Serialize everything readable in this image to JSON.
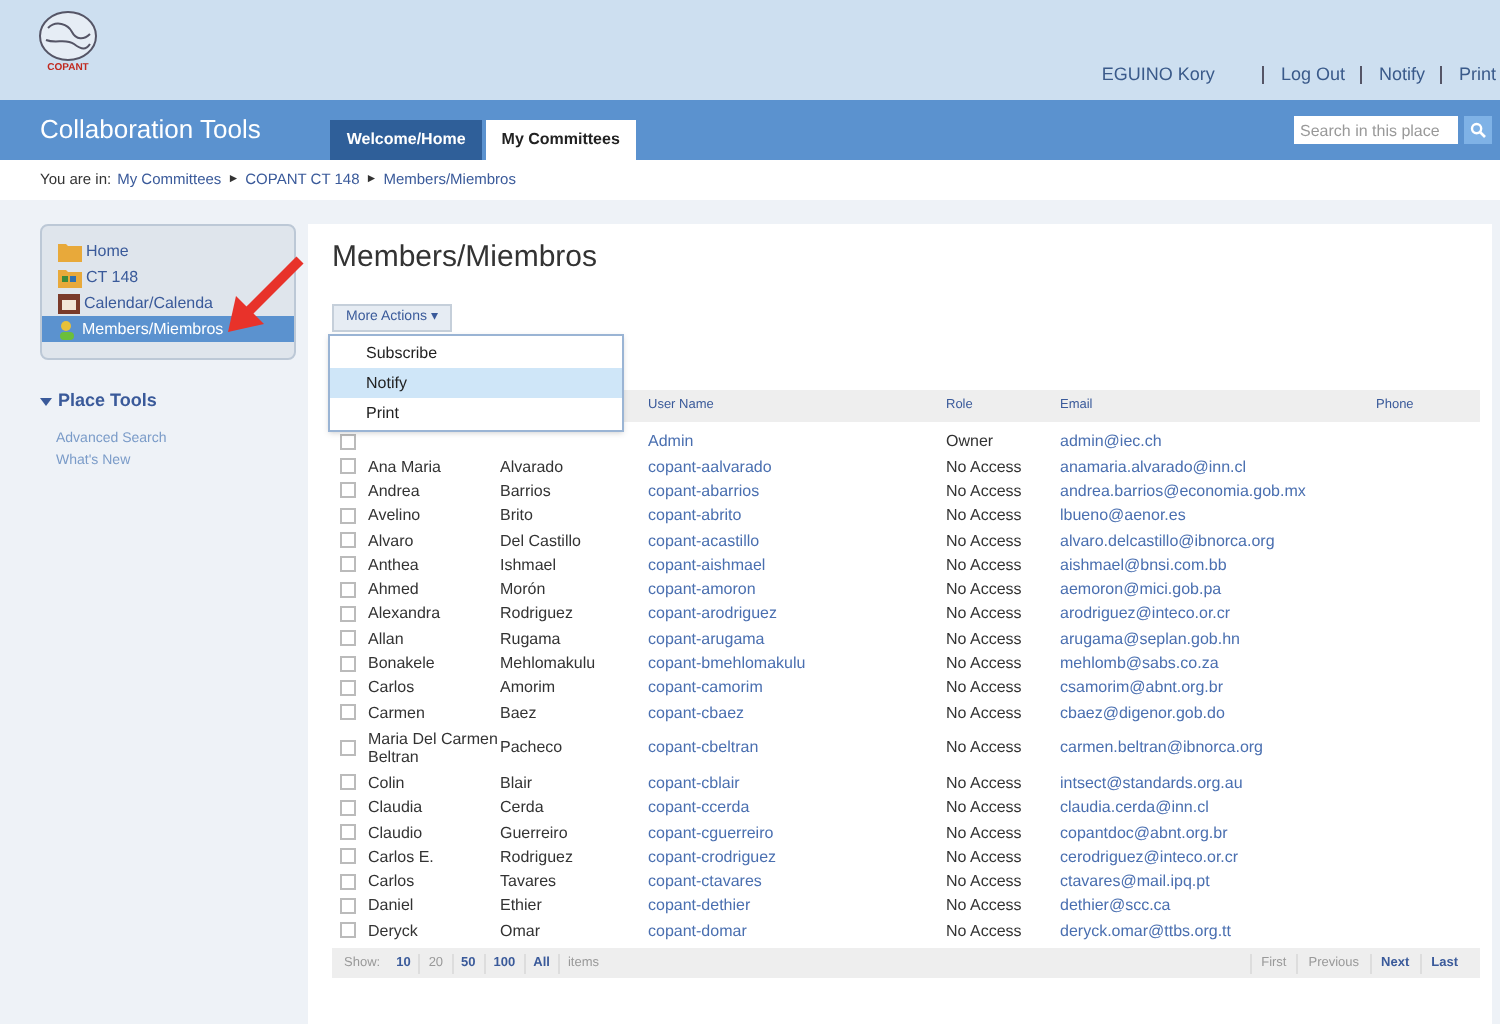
{
  "logo": {
    "text": "COPANT"
  },
  "user_links": [
    "EGUINO Kory",
    "Log Out",
    "Notify",
    "Print"
  ],
  "app_title": "Collaboration Tools",
  "tabs": [
    {
      "label": "Welcome/Home",
      "selected": false
    },
    {
      "label": "My Committees",
      "selected": true
    }
  ],
  "search": {
    "placeholder": "Search in this place"
  },
  "breadcrumb": {
    "label": "You are in:",
    "items": [
      "My Committees",
      "COPANT CT 148",
      "Members/Miembros"
    ],
    "separator": "►"
  },
  "sidebar": {
    "items": [
      {
        "label": "Home",
        "selected": false
      },
      {
        "label": "CT 148",
        "selected": false
      },
      {
        "label": "Calendar/Calenda",
        "selected": false
      },
      {
        "label": "Members/Miembros",
        "selected": true
      }
    ],
    "tools_title": "Place Tools",
    "tools_expanded": true,
    "tools": [
      "Advanced Search",
      "What's New"
    ]
  },
  "page_title": "Members/Miembros",
  "actions_button": "More Actions ▾",
  "actions_menu": [
    {
      "label": "Subscribe",
      "selected": false
    },
    {
      "label": "Notify",
      "selected": true
    },
    {
      "label": "Print",
      "selected": false
    }
  ],
  "table": {
    "columns": [
      "User Name",
      "Role",
      "Email",
      "Phone"
    ],
    "rows": [
      {
        "first": "",
        "last": "",
        "user": "Admin",
        "role": "Owner",
        "email": "admin@iec.ch",
        "checked": false
      },
      {
        "first": "Ana Maria",
        "last": "Alvarado",
        "user": "copant-aalvarado",
        "role": "No Access",
        "email": "anamaria.alvarado@inn.cl",
        "checked": false
      },
      {
        "first": "Andrea",
        "last": "Barrios",
        "user": "copant-abarrios",
        "role": "No Access",
        "email": "andrea.barrios@economia.gob.mx",
        "checked": false
      },
      {
        "first": "Avelino",
        "last": "Brito",
        "user": "copant-abrito",
        "role": "No Access",
        "email": "lbueno@aenor.es",
        "checked": false
      },
      {
        "first": "Alvaro",
        "last": "Del Castillo",
        "user": "copant-acastillo",
        "role": "No Access",
        "email": "alvaro.delcastillo@ibnorca.org",
        "checked": false
      },
      {
        "first": "Anthea",
        "last": "Ishmael",
        "user": "copant-aishmael",
        "role": "No Access",
        "email": "aishmael@bnsi.com.bb",
        "checked": false
      },
      {
        "first": "Ahmed",
        "last": "Morón",
        "user": "copant-amoron",
        "role": "No Access",
        "email": "aemoron@mici.gob.pa",
        "checked": false
      },
      {
        "first": "Alexandra",
        "last": "Rodriguez",
        "user": "copant-arodriguez",
        "role": "No Access",
        "email": "arodriguez@inteco.or.cr",
        "checked": false
      },
      {
        "first": "Allan",
        "last": "Rugama",
        "user": "copant-arugama",
        "role": "No Access",
        "email": "arugama@seplan.gob.hn",
        "checked": false
      },
      {
        "first": "Bonakele",
        "last": "Mehlomakulu",
        "user": "copant-bmehlomakulu",
        "role": "No Access",
        "email": "mehlomb@sabs.co.za",
        "checked": false
      },
      {
        "first": "Carlos",
        "last": "Amorim",
        "user": "copant-camorim",
        "role": "No Access",
        "email": "csamorim@abnt.org.br",
        "checked": false
      },
      {
        "first": "Carmen",
        "last": "Baez",
        "user": "copant-cbaez",
        "role": "No Access",
        "email": "cbaez@digenor.gob.do",
        "checked": false
      },
      {
        "first": "Maria Del Carmen Beltran",
        "last": "Pacheco",
        "user": "copant-cbeltran",
        "role": "No Access",
        "email": "carmen.beltran@ibnorca.org",
        "checked": false
      },
      {
        "first": "Colin",
        "last": "Blair",
        "user": "copant-cblair",
        "role": "No Access",
        "email": "intsect@standards.org.au",
        "checked": false
      },
      {
        "first": "Claudia",
        "last": "Cerda",
        "user": "copant-ccerda",
        "role": "No Access",
        "email": "claudia.cerda@inn.cl",
        "checked": false
      },
      {
        "first": "Claudio",
        "last": "Guerreiro",
        "user": "copant-cguerreiro",
        "role": "No Access",
        "email": "copantdoc@abnt.org.br",
        "checked": false
      },
      {
        "first": "Carlos E.",
        "last": "Rodriguez",
        "user": "copant-crodriguez",
        "role": "No Access",
        "email": "cerodriguez@inteco.or.cr",
        "checked": false
      },
      {
        "first": "Carlos",
        "last": "Tavares",
        "user": "copant-ctavares",
        "role": "No Access",
        "email": "ctavares@mail.ipq.pt",
        "checked": false
      },
      {
        "first": "Daniel",
        "last": "Ethier",
        "user": "copant-dethier",
        "role": "No Access",
        "email": "dethier@scc.ca",
        "checked": false
      },
      {
        "first": "Deryck",
        "last": "Omar",
        "user": "copant-domar",
        "role": "No Access",
        "email": "deryck.omar@ttbs.org.tt",
        "checked": false
      }
    ]
  },
  "pager": {
    "show_label": "Show:",
    "sizes": [
      {
        "label": "10",
        "selected": false
      },
      {
        "label": "20",
        "selected": true
      },
      {
        "label": "50",
        "selected": false
      },
      {
        "label": "100",
        "selected": false
      },
      {
        "label": "All",
        "selected": false
      }
    ],
    "items_label": "items",
    "nav": [
      {
        "label": "First",
        "disabled": true
      },
      {
        "label": "Previous",
        "disabled": true
      },
      {
        "label": "Next",
        "disabled": false
      },
      {
        "label": "Last",
        "disabled": false
      }
    ]
  }
}
